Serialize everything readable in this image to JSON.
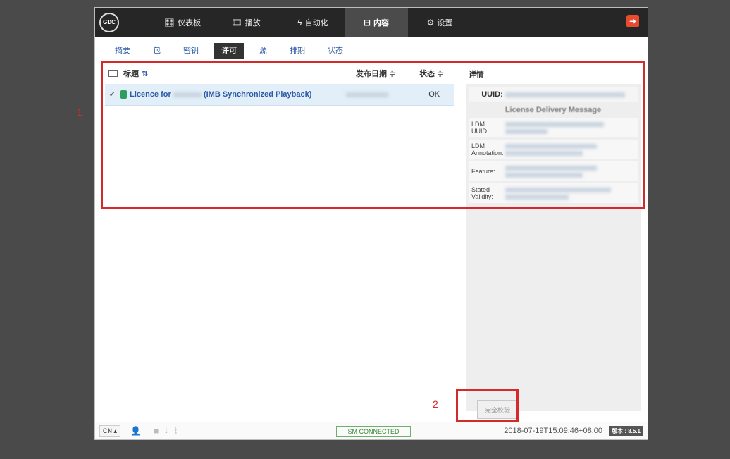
{
  "nav": {
    "logo": "GDC",
    "items": [
      {
        "icon": "🎛",
        "label": "仪表板"
      },
      {
        "icon": "🎞",
        "label": "播放"
      },
      {
        "icon": "ϟ",
        "label": "自动化"
      },
      {
        "icon": "⊟",
        "label": "内容"
      },
      {
        "icon": "⚙",
        "label": "设置"
      }
    ]
  },
  "subtabs": [
    "摘要",
    "包",
    "密钥",
    "许可",
    "源",
    "排期",
    "状态"
  ],
  "table": {
    "headers": {
      "title": "标题",
      "date": "发布日期 ≑",
      "status": "状态 ≑"
    },
    "rows": [
      {
        "title_prefix": "Licence for",
        "title_suffix": "(IMB Synchronized Playback)",
        "status": "OK"
      }
    ]
  },
  "details": {
    "label": "详情",
    "uuid_label": "UUID:",
    "ldm_title": "License Delivery Message",
    "fields": [
      {
        "key": "LDM UUID:"
      },
      {
        "key": "LDM Annotation:"
      },
      {
        "key": "Feature:"
      },
      {
        "key": "Stated Validity:"
      }
    ]
  },
  "validate_button": "完全校验",
  "annotations": {
    "one": "1",
    "two": "2"
  },
  "footer": {
    "lang": "CN ▴",
    "sm_status": "SM CONNECTED",
    "timestamp": "2018-07-19T15:09:46+08:00",
    "version": "版本 : 8.5.1"
  },
  "colors": {
    "accent": "#2b5aa7",
    "annotation": "#d42a2a",
    "nav_bg": "#262626",
    "row_selected": "#e2eef8"
  }
}
